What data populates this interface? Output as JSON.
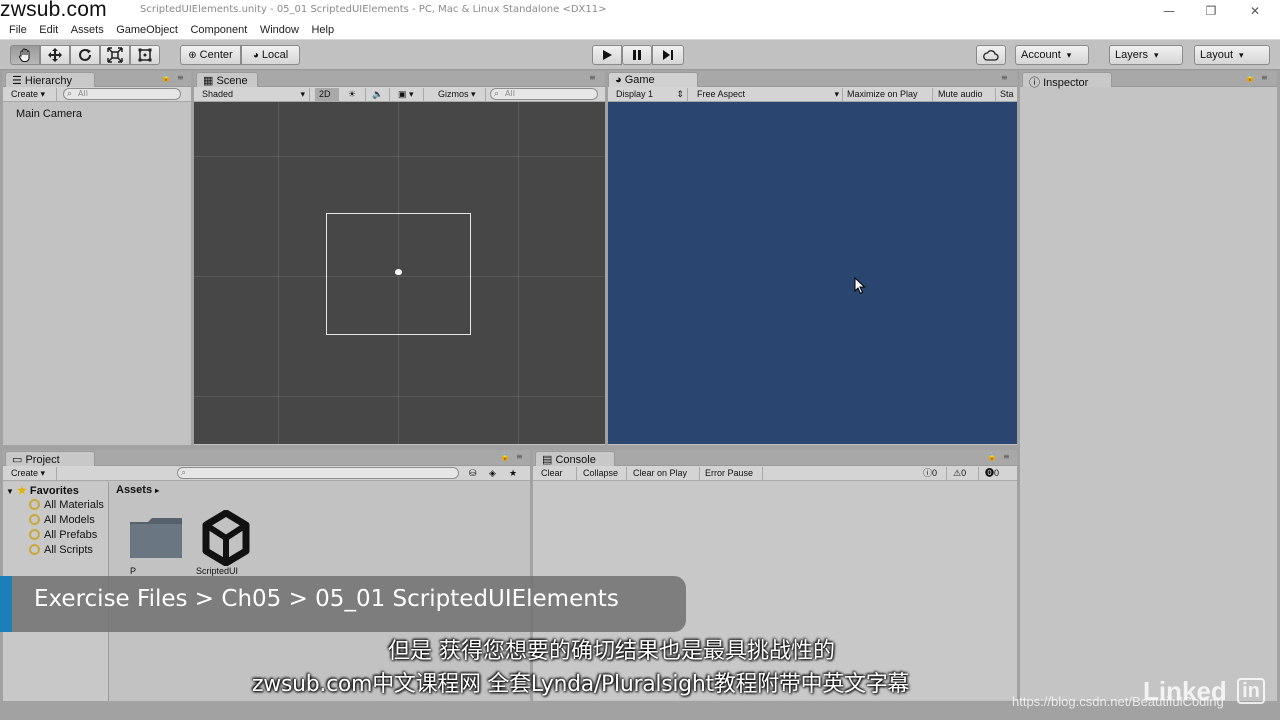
{
  "window": {
    "title": "ScriptedUIElements.unity - 05_01 ScriptedUIElements - PC, Mac & Linux Standalone <DX11>",
    "watermark": "zwsub.com",
    "controls": [
      "—",
      "❐",
      "✕"
    ]
  },
  "menu": [
    "File",
    "Edit",
    "Assets",
    "GameObject",
    "Component",
    "Window",
    "Help"
  ],
  "toolbar": {
    "pivot_center": "Center",
    "pivot_local": "Local",
    "account": "Account",
    "layers": "Layers",
    "layout": "Layout"
  },
  "hierarchy": {
    "tab": "Hierarchy",
    "create": "Create",
    "search_placeholder": "All",
    "items": [
      "Main Camera"
    ]
  },
  "scene": {
    "tab": "Scene",
    "shading": "Shaded",
    "mode_2d": "2D",
    "gizmos": "Gizmos",
    "search_placeholder": "All"
  },
  "game": {
    "tab": "Game",
    "display": "Display 1",
    "aspect": "Free Aspect",
    "maximize": "Maximize on Play",
    "mute": "Mute audio",
    "stats": "Sta",
    "background": "#2a4670"
  },
  "inspector": {
    "tab": "Inspector"
  },
  "project": {
    "tab": "Project",
    "create": "Create",
    "favorites": "Favorites",
    "favorite_items": [
      "All Materials",
      "All Models",
      "All Prefabs",
      "All Scripts"
    ],
    "breadcrumb": "Assets",
    "asset_labels": [
      "P",
      "ScriptedUI"
    ]
  },
  "console": {
    "tab": "Console",
    "buttons": [
      "Clear",
      "Collapse",
      "Clear on Play",
      "Error Pause"
    ],
    "counts": {
      "logs": "0",
      "warnings": "0",
      "errors": "0"
    }
  },
  "overlay": {
    "path": "Exercise Files > Ch05 > 05_01 ScriptedUIElements",
    "subtitle_cn": "但是 获得您想要的确切结果也是最具挑战性的",
    "subtitle_ad": "zwsub.com中文课程网 全套Lynda/Pluralsight教程附带中英文字幕",
    "linkedin": "Linked",
    "blog": "https://blog.csdn.net/BeautifulCoding"
  },
  "colors": {
    "accent_banner": "#1e7fb8",
    "game_view": "#2a4670",
    "scene_bg": "#474747"
  }
}
